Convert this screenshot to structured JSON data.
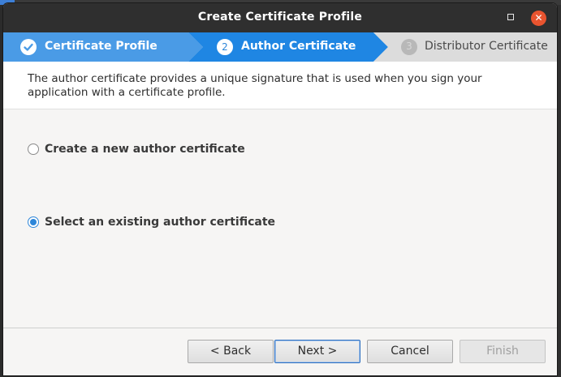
{
  "window": {
    "title": "Create Certificate Profile",
    "max_icon": "maximize-icon",
    "close_glyph": "✕"
  },
  "wizard": {
    "steps": [
      {
        "number": "✓",
        "label": "Certificate Profile",
        "state": "done"
      },
      {
        "number": "2",
        "label": "Author Certificate",
        "state": "active"
      },
      {
        "number": "3",
        "label": "Distributor Certificate",
        "state": "inactive"
      }
    ],
    "colors": {
      "done": "#4a9be6",
      "active": "#1f86e3",
      "inactive": "#dcdcdc"
    }
  },
  "description": "The author certificate provides a unique signature that is used when you sign your application with a certificate profile.",
  "options": [
    {
      "label": "Create a new author certificate",
      "selected": false
    },
    {
      "label": "Select an existing author certificate",
      "selected": true
    }
  ],
  "buttons": {
    "back": "< Back",
    "next": "Next >",
    "cancel": "Cancel",
    "finish": "Finish"
  }
}
